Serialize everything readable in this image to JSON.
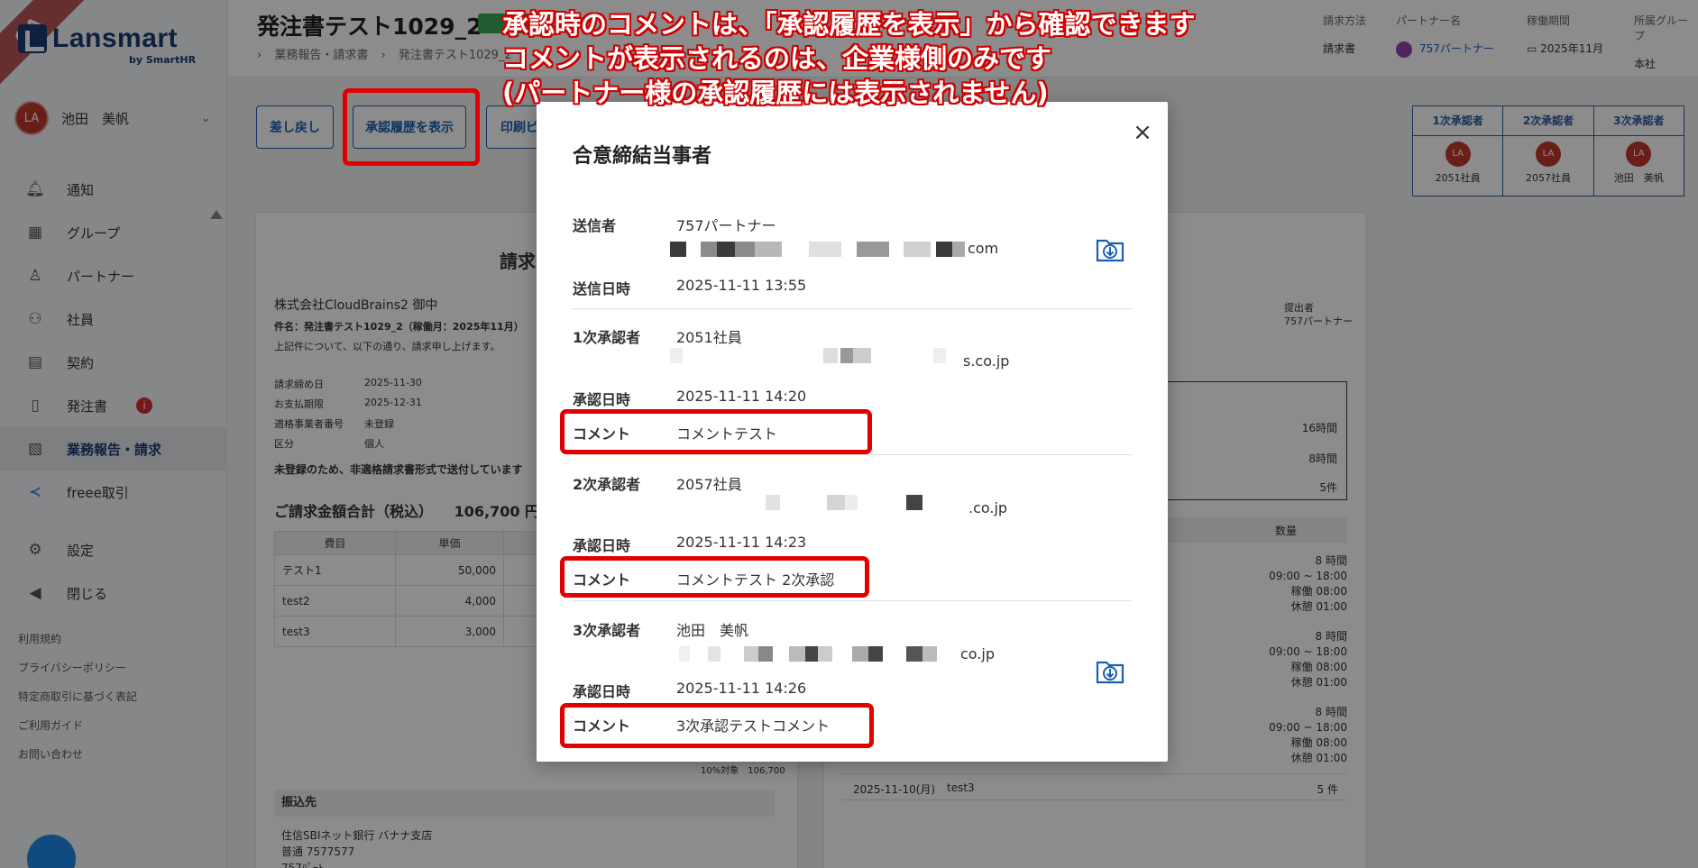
{
  "sidebar": {
    "badge": "QA",
    "logo": "Lansmart",
    "logo_sub": "by SmartHR",
    "user": {
      "initials": "LA",
      "name": "池田　美帆"
    },
    "items": [
      {
        "label": "通知",
        "icon": "bell-icon"
      },
      {
        "label": "グループ",
        "icon": "building-icon"
      },
      {
        "label": "パートナー",
        "icon": "person-icon"
      },
      {
        "label": "社員",
        "icon": "people-icon"
      },
      {
        "label": "契約",
        "icon": "contract-icon"
      },
      {
        "label": "発注書",
        "icon": "document-icon",
        "badge": "i"
      },
      {
        "label": "業務報告・請求",
        "icon": "invoice-icon",
        "active": true
      },
      {
        "label": "freee取引",
        "icon": "freee-icon"
      },
      {
        "label": "設定",
        "icon": "gear-icon"
      },
      {
        "label": "閉じる",
        "icon": "collapse-icon"
      }
    ],
    "footer": [
      "利用規約",
      "プライバシーポリシー",
      "特定商取引に基づく表記",
      "ご利用ガイド",
      "お問い合わせ"
    ]
  },
  "header": {
    "title": "発注書テスト1029_2",
    "breadcrumb": [
      "業務報告・請求書",
      "発注書テスト1029_2"
    ],
    "meta": {
      "billing_method_label": "請求方法",
      "billing_method": "請求書",
      "partner_label": "パートナー名",
      "partner": "757パートナー",
      "period_label": "稼働期間",
      "period": "2025年11月",
      "group_label": "所属グループ",
      "group": "本社"
    }
  },
  "actions": {
    "send_back": "差し戻し",
    "show_history": "承認履歴を表示",
    "print": "印刷ピ"
  },
  "approvers": [
    {
      "head": "1次承認者",
      "initials": "LA",
      "name": "2051社員"
    },
    {
      "head": "2次承認者",
      "initials": "LA",
      "name": "2057社員"
    },
    {
      "head": "3次承認者",
      "initials": "LA",
      "name": "池田　美帆"
    }
  ],
  "invoice": {
    "title": "請求",
    "to": "株式会社CloudBrains2 御中",
    "subject": "件名：発注書テスト1029_2（稼働月：2025年11月）",
    "intro": "上記件について、以下の通り、請求申し上げます。",
    "closing_label": "請求締め日",
    "closing": "2025-11-30",
    "due_label": "お支払期限",
    "due": "2025-12-31",
    "reg_label": "適格事業者番号",
    "reg": "未登録",
    "type_label": "区分",
    "type": "個人",
    "notice": "未登録のため、非適格請求書形式で送付しています",
    "total_label": "ご請求金額合計（税込）",
    "total": "106,700 円",
    "columns": [
      "費目",
      "単価"
    ],
    "rows": [
      {
        "item": "テスト1",
        "price": "50,000"
      },
      {
        "item": "test2",
        "price": "4,000"
      },
      {
        "item": "test3",
        "price": "3,000"
      }
    ],
    "tax_line": "10%対象　106,700",
    "bank_head": "振込先",
    "bank_lines": [
      "住信SBIネット銀行 バナナ支店",
      "普通 7577577",
      "757ﾊﾟｰﾄ"
    ]
  },
  "report": {
    "submitter_label": "提出者",
    "submitter": "757パートナー",
    "summary": [
      "16時間",
      "8時間",
      "5件"
    ],
    "qty_header": "数量",
    "qty_blocks": [
      [
        "8 時間",
        "09:00 ~ 18:00",
        "稼働 08:00",
        "休憩 01:00"
      ],
      [
        "8 時間",
        "09:00 ~ 18:00",
        "稼働 08:00",
        "休憩 01:00"
      ],
      [
        "8 時間",
        "09:00 ~ 18:00",
        "稼働 08:00",
        "休憩 01:00"
      ]
    ],
    "last_row": {
      "date": "2025-11-10(月)",
      "item": "test3",
      "qty": "5 件"
    }
  },
  "modal": {
    "title": "合意締結当事者",
    "close": "×",
    "sender_label": "送信者",
    "sender": "757パートナー",
    "sender_email_tail": "com",
    "sent_at_label": "送信日時",
    "sent_at": "2025-11-11 13:55",
    "approval_label": "承認日時",
    "comment_label": "コメント",
    "approvers": [
      {
        "label": "1次承認者",
        "name": "2051社員",
        "email_tail": "s.co.jp",
        "approved_at": "2025-11-11 14:20",
        "comment": "コメントテスト"
      },
      {
        "label": "2次承認者",
        "name": "2057社員",
        "email_tail": ".co.jp",
        "approved_at": "2025-11-11 14:23",
        "comment": "コメントテスト 2次承認"
      },
      {
        "label": "3次承認者",
        "name": "池田　美帆",
        "email_tail": "co.jp",
        "approved_at": "2025-11-11 14:26",
        "comment": "3次承認テストコメント"
      }
    ]
  },
  "annotation": {
    "lines": [
      "承認時のコメントは、「承認履歴を表示」から確認できます",
      "コメントが表示されるのは、企業様側のみです",
      "(パートナー様の承認履歴には表示されません)"
    ]
  },
  "colors": {
    "brand": "#1a3b72",
    "accent": "#1a5fb4",
    "highlight": "#e00000",
    "status": "#3ea65a"
  }
}
